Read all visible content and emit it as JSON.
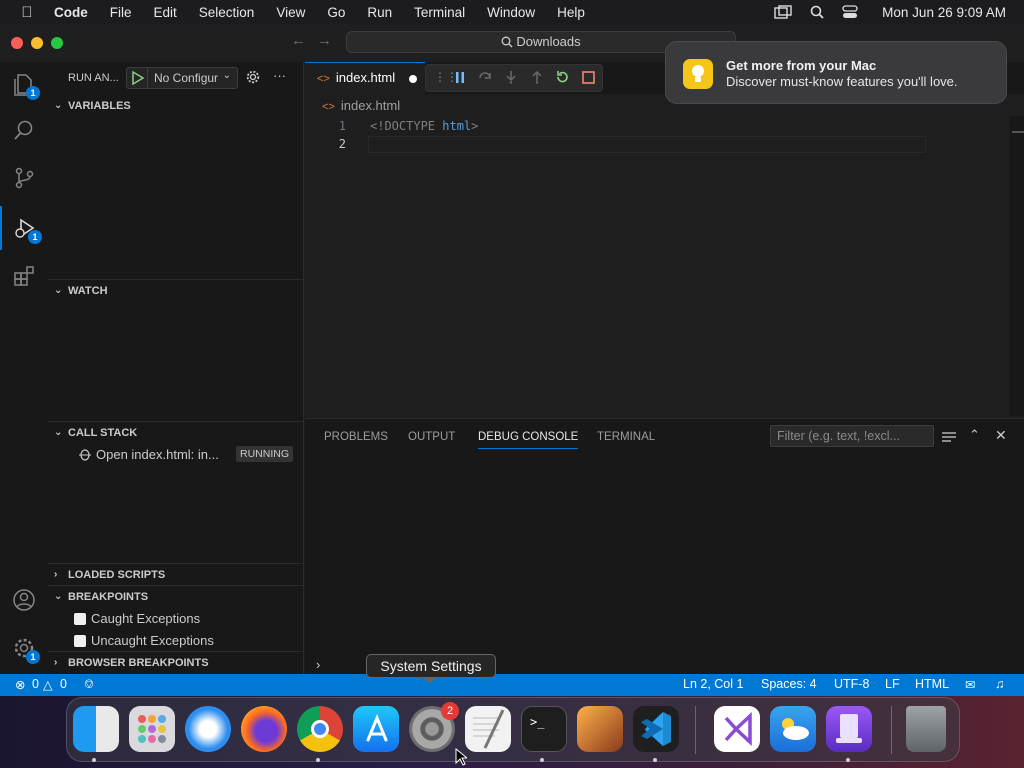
{
  "menubar": {
    "app": "Code",
    "items": [
      "File",
      "Edit",
      "Selection",
      "View",
      "Go",
      "Run",
      "Terminal",
      "Window",
      "Help"
    ],
    "clock": "Mon Jun 26  9:09 AM"
  },
  "titlebar": {
    "command_center": "Downloads"
  },
  "notification": {
    "title": "Get more from your Mac",
    "body": "Discover must-know features you'll love."
  },
  "activity": {
    "explorer_badge": "1",
    "debug_badge": "1",
    "settings_badge": "1"
  },
  "sidebar": {
    "header": "RUN AN...",
    "config": "No Configur",
    "sections": {
      "variables": "VARIABLES",
      "watch": "WATCH",
      "call_stack": "CALL STACK",
      "loaded_scripts": "LOADED SCRIPTS",
      "breakpoints": "BREAKPOINTS",
      "browser_breakpoints": "BROWSER BREAKPOINTS"
    },
    "call_stack_item": "Open index.html: in...",
    "call_stack_status": "RUNNING",
    "breakpoint_items": [
      "Caught Exceptions",
      "Uncaught Exceptions"
    ]
  },
  "editor": {
    "tab": "index.html",
    "breadcrumb": "index.html",
    "lines": [
      {
        "num": "1",
        "doctype": "<!DOCTYPE ",
        "tag": "html",
        "close": ">"
      },
      {
        "num": "2"
      }
    ]
  },
  "panel": {
    "tabs": [
      "PROBLEMS",
      "OUTPUT",
      "DEBUG CONSOLE",
      "TERMINAL"
    ],
    "active_tab": "DEBUG CONSOLE",
    "filter_placeholder": "Filter (e.g. text, !excl..."
  },
  "status": {
    "errors": "0",
    "warnings": "0",
    "position": "Ln 2, Col 1",
    "spaces": "Spaces: 4",
    "encoding": "UTF-8",
    "eol": "LF",
    "language": "HTML"
  },
  "tooltip": "System Settings",
  "dock": {
    "settings_badge": "2"
  },
  "colors": {
    "accent": "#0078d4",
    "status_bar": "#0078d4",
    "notif_icon": "#f5c518"
  }
}
